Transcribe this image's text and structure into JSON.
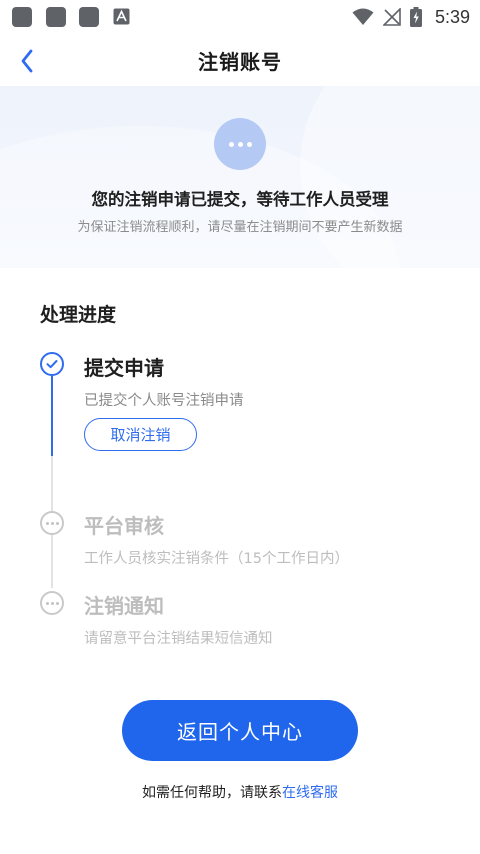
{
  "status_bar": {
    "time": "5:39",
    "icons": [
      "app-icon",
      "app-icon",
      "app-icon",
      "a-icon",
      "wifi-icon",
      "no-signal-icon",
      "battery-charging-icon"
    ]
  },
  "nav": {
    "back_icon": "chevron-left-icon",
    "title": "注销账号"
  },
  "banner": {
    "status_icon": "more-dots-icon",
    "title": "您的注销申请已提交，等待工作人员受理",
    "subtitle": "为保证注销流程顺利，请尽量在注销期间不要产生新数据"
  },
  "progress": {
    "title": "处理进度",
    "steps": [
      {
        "title": "提交申请",
        "desc": "已提交个人账号注销申请",
        "status": "done",
        "icon": "check-circle-icon",
        "action_label": "取消注销"
      },
      {
        "title": "平台审核",
        "desc": "工作人员核实注销条件（15个工作日内）",
        "status": "pending",
        "icon": "more-dots-icon"
      },
      {
        "title": "注销通知",
        "desc": "请留意平台注销结果短信通知",
        "status": "pending",
        "icon": "more-dots-icon"
      }
    ]
  },
  "footer": {
    "return_label": "返回个人中心",
    "help_prefix": "如需任何帮助，请联系",
    "help_link": "在线客服"
  },
  "colors": {
    "accent": "#2f6cf0",
    "button": "#1f66ec",
    "banner_bg": "#eef3fc",
    "muted": "#bdbdbd"
  }
}
